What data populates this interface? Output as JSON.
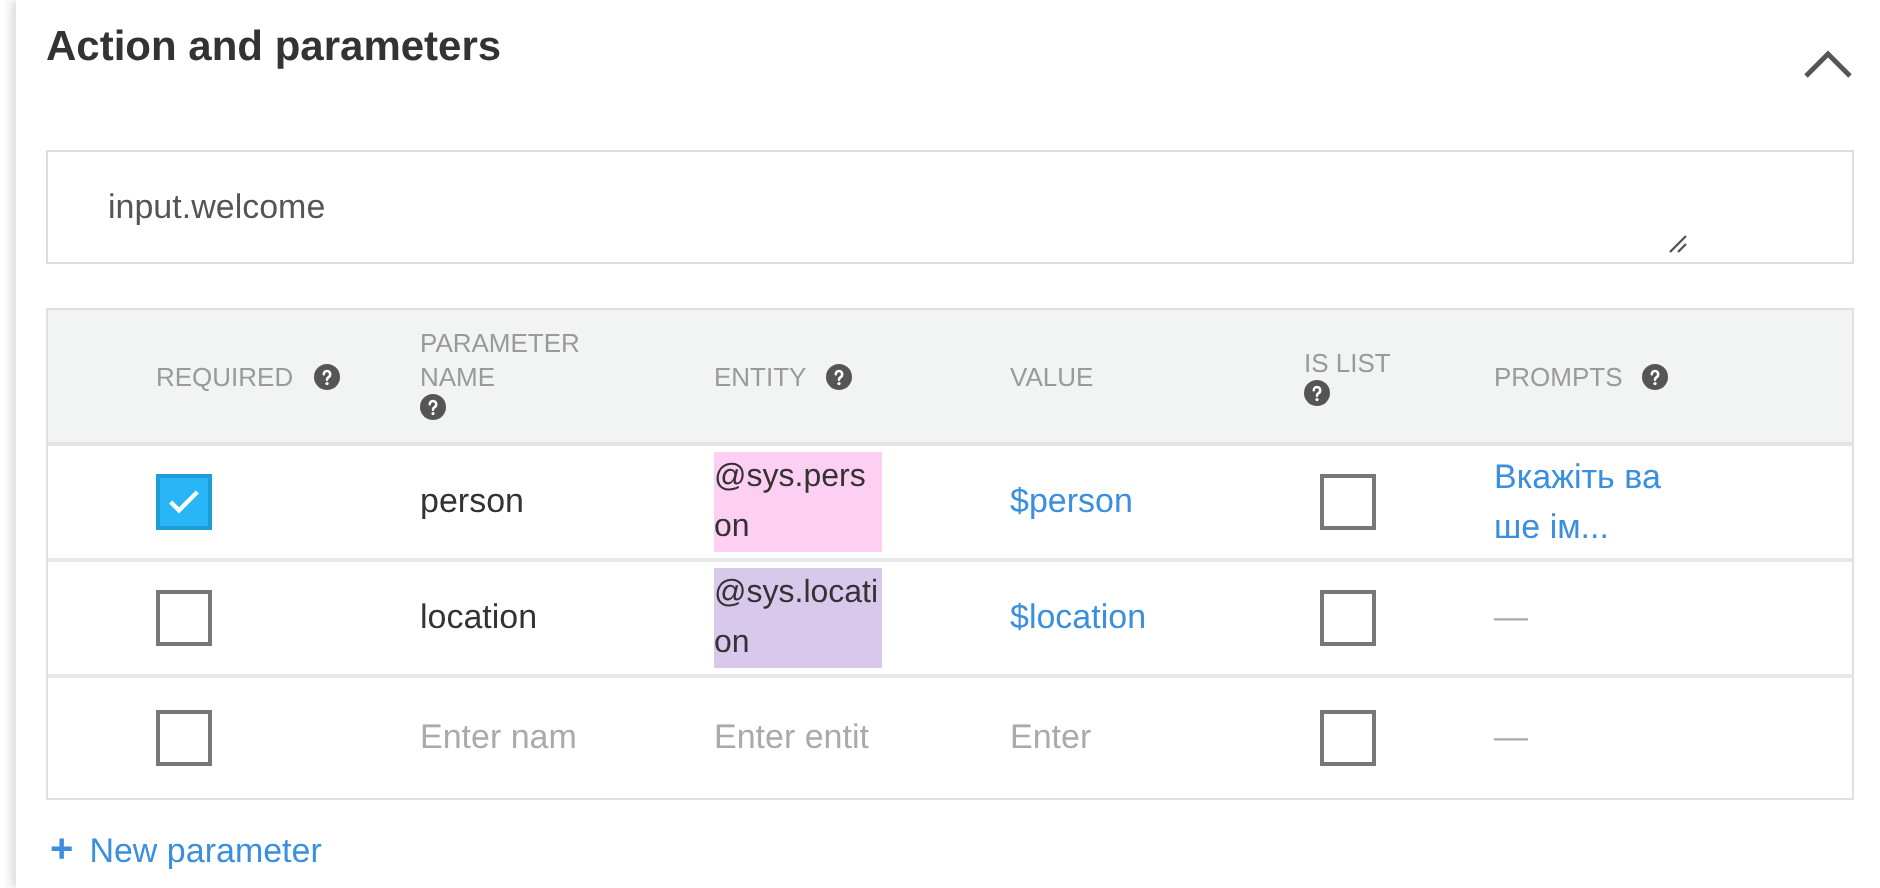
{
  "section": {
    "title": "Action and parameters",
    "expanded": true
  },
  "action": {
    "value": "input.welcome"
  },
  "table": {
    "columns": [
      {
        "label": "REQUIRED",
        "help": true
      },
      {
        "label": "PARAMETER NAME",
        "help": true
      },
      {
        "label": "ENTITY",
        "help": true
      },
      {
        "label": "VALUE",
        "help": false
      },
      {
        "label": "IS LIST",
        "help": true
      },
      {
        "label": "PROMPTS",
        "help": true
      }
    ],
    "rows": [
      {
        "required": true,
        "name": "person",
        "entity": "@sys.person",
        "color": "#fdd0f3",
        "value": "$person",
        "is_list": false,
        "prompts": "Вкажіть ваше ім..."
      },
      {
        "required": false,
        "name": "location",
        "entity": "@sys.location",
        "color": "#d8c8ec",
        "value": "$location",
        "is_list": false,
        "prompts": "—"
      },
      {
        "required": false,
        "name_placeholder": "Enter nam",
        "entity_placeholder": "Enter entit",
        "value_placeholder": "Enter",
        "is_list": false,
        "prompts": "—"
      }
    ]
  },
  "add_button": {
    "icon": "+",
    "label": "New parameter"
  }
}
